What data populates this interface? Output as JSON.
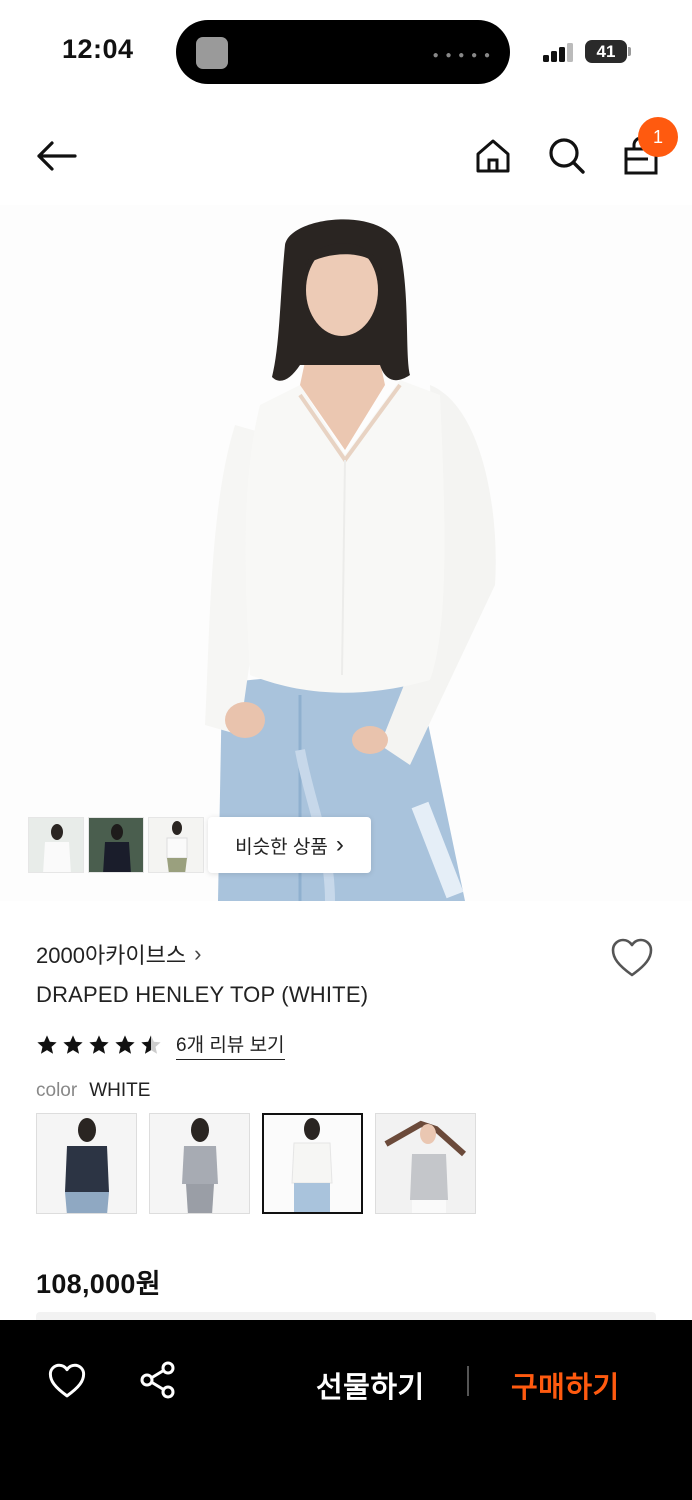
{
  "status_bar": {
    "time": "12:04",
    "battery": "41",
    "signal_bars_filled": 3
  },
  "nav": {
    "back_icon": "arrow-left-icon",
    "home_icon": "home-icon",
    "search_icon": "search-icon",
    "cart_icon": "shopping-bag-icon",
    "cart_count": "1"
  },
  "hero": {
    "similar_label": "비슷한 상품",
    "similar_arrow": "›"
  },
  "product": {
    "brand": "2000아카이브스",
    "brand_arrow": "›",
    "title": "DRAPED HENLEY TOP (WHITE)",
    "rating": 4.5,
    "review_link": "6개 리뷰 보기",
    "color_label": "color",
    "color_value": "WHITE",
    "swatches_count": 4,
    "selected_swatch_index": 2,
    "price": "108,000원"
  },
  "bottom_bar": {
    "wishlist_icon": "heart-icon",
    "share_icon": "share-icon",
    "gift_label": "선물하기",
    "buy_label": "구매하기"
  },
  "colors": {
    "accent": "#ff5a0f",
    "bottom_bar_bg": "#000000"
  }
}
